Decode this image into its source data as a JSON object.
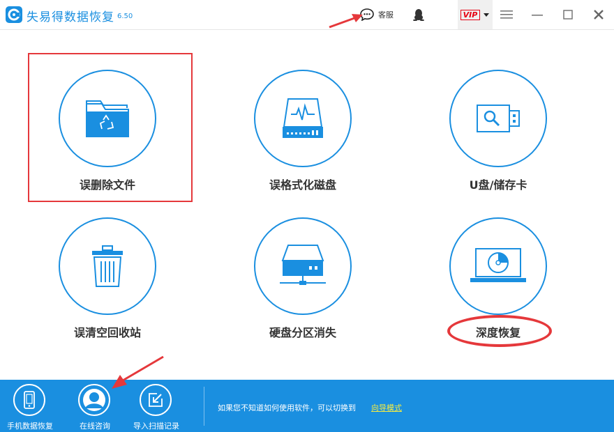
{
  "app": {
    "title": "失易得数据恢复",
    "version": "6.50"
  },
  "titlebar": {
    "support_label": "客服",
    "vip_label": "VIP"
  },
  "tiles": [
    {
      "label": "误删除文件",
      "icon": "folder-recycle-icon"
    },
    {
      "label": "误格式化磁盘",
      "icon": "hard-drive-pulse-icon"
    },
    {
      "label": "U盘/储存卡",
      "icon": "usb-drive-icon"
    },
    {
      "label": "误清空回收站",
      "icon": "trash-bin-icon"
    },
    {
      "label": "硬盘分区消失",
      "icon": "network-drive-icon"
    },
    {
      "label": "深度恢复",
      "icon": "laptop-disk-icon"
    }
  ],
  "bottombar": {
    "items": [
      {
        "label": "手机数据恢复",
        "icon": "phone-icon"
      },
      {
        "label": "在线咨询",
        "icon": "user-avatar-icon"
      },
      {
        "label": "导入扫描记录",
        "icon": "import-icon"
      }
    ],
    "hint": "如果您不知道如何使用软件，可以切换到",
    "link": "向导模式"
  },
  "colors": {
    "accent": "#1a8fe0",
    "annotation": "#e5383b",
    "link": "#f5ec42"
  }
}
